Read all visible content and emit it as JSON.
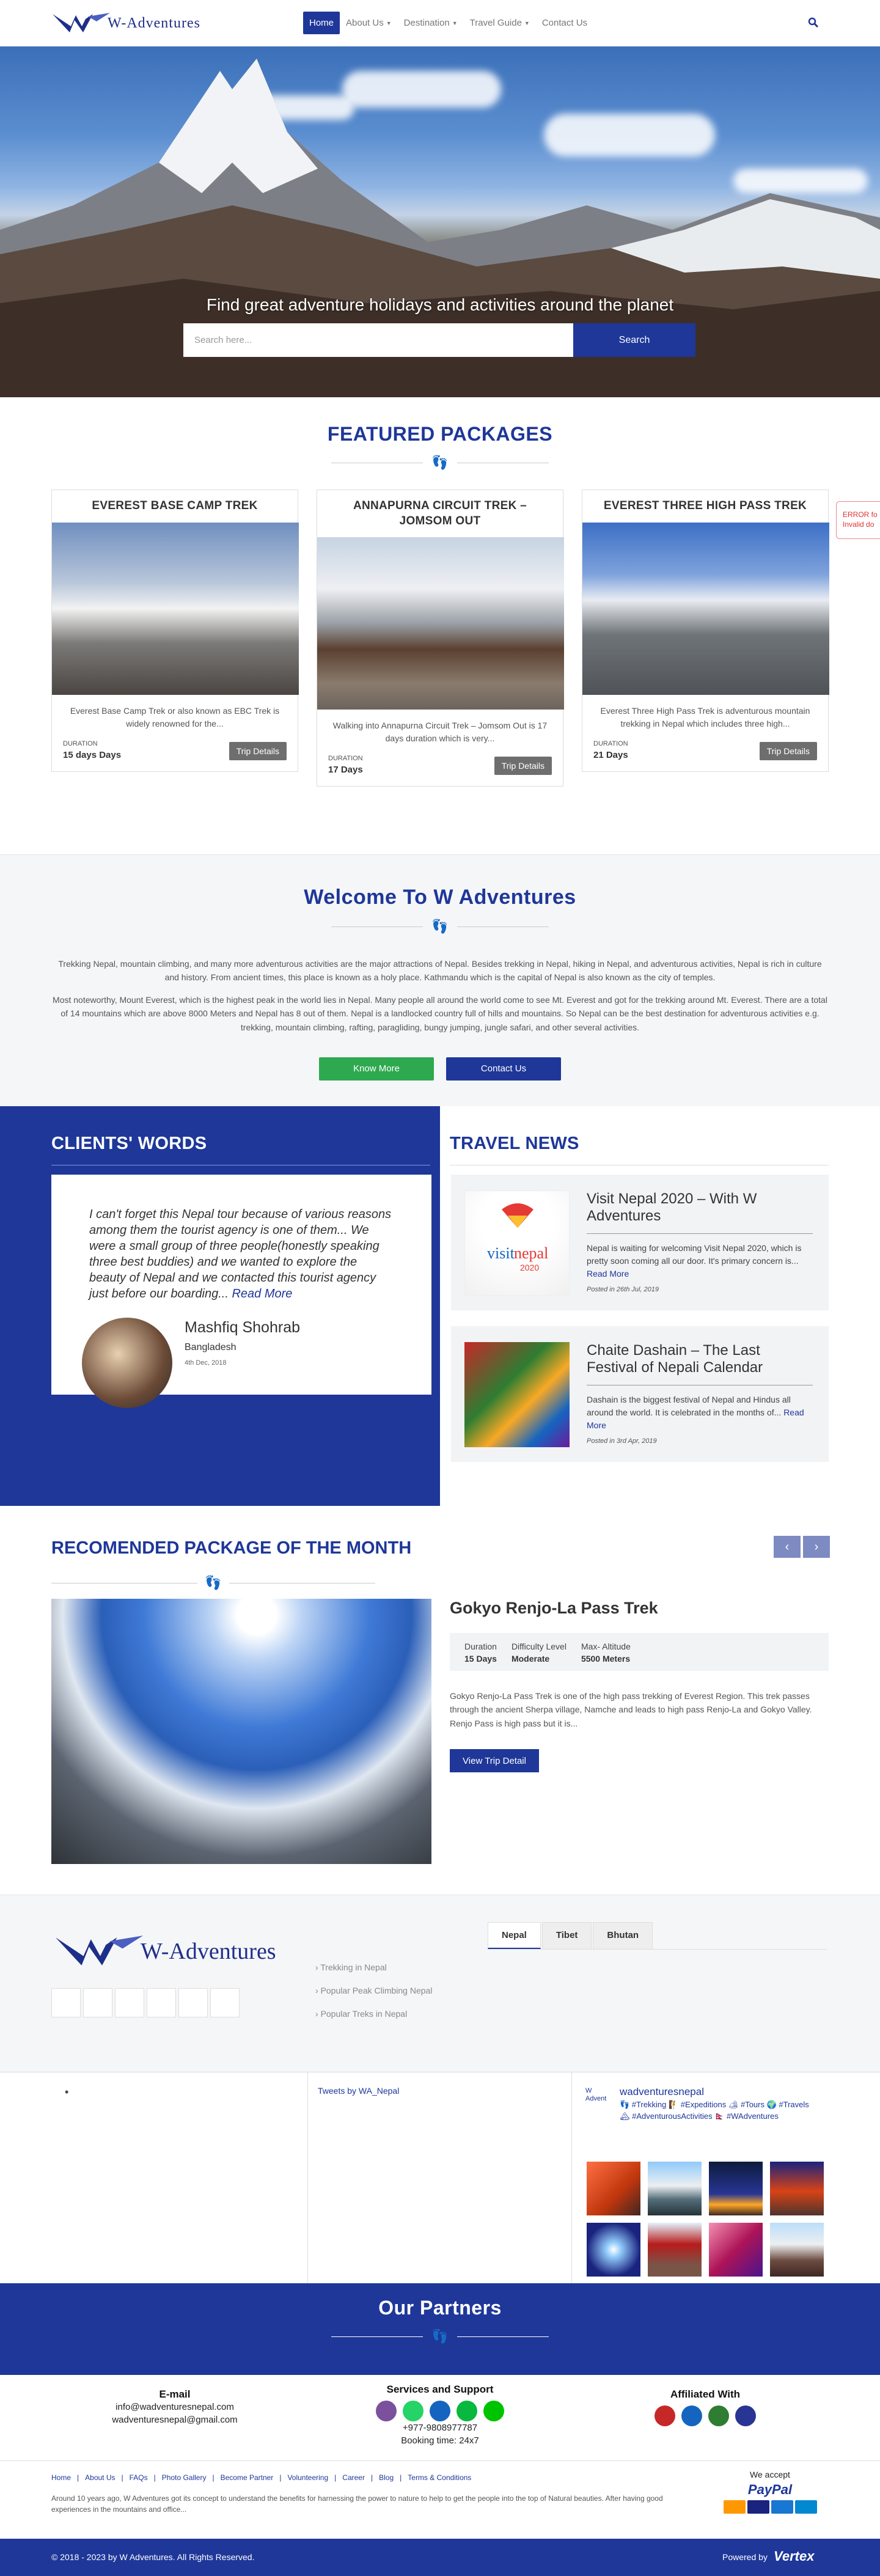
{
  "header": {
    "logo_text": "W-Adventures",
    "nav": [
      {
        "label": "Home",
        "active": true,
        "dropdown": false
      },
      {
        "label": "About Us",
        "active": false,
        "dropdown": true
      },
      {
        "label": "Destination",
        "active": false,
        "dropdown": true
      },
      {
        "label": "Travel Guide",
        "active": false,
        "dropdown": true
      },
      {
        "label": "Contact Us",
        "active": false,
        "dropdown": false
      }
    ],
    "search_icon": "search-icon"
  },
  "hero": {
    "title": "Find great adventure holidays and activities around the planet",
    "search_placeholder": "Search here...",
    "search_button": "Search"
  },
  "featured": {
    "title": "FEATURED PACKAGES",
    "packages": [
      {
        "title": "EVEREST BASE CAMP TREK",
        "desc": "Everest Base Camp Trek or also known as EBC Trek is widely renowned for the...",
        "duration_label": "DURATION",
        "duration": "15 days Days",
        "button": "Trip Details"
      },
      {
        "title": "ANNAPURNA CIRCUIT TREK – JOMSOM OUT",
        "desc": "Walking into Annapurna Circuit Trek – Jomsom Out is 17 days duration which is very...",
        "duration_label": "DURATION",
        "duration": "17 Days",
        "button": "Trip Details"
      },
      {
        "title": "EVEREST THREE HIGH PASS TREK",
        "desc": "Everest Three High Pass Trek is adventurous mountain trekking in Nepal which includes three high...",
        "duration_label": "DURATION",
        "duration": "21 Days",
        "button": "Trip Details"
      }
    ],
    "error_text": "ERROR fo Invalid do"
  },
  "welcome": {
    "title": "Welcome To W Adventures",
    "p1": "Trekking Nepal, mountain climbing, and many more adventurous activities are the major attractions of Nepal. Besides trekking in Nepal, hiking in Nepal, and adventurous activities, Nepal is rich in culture and history. From ancient times, this place is known as a holy place. Kathmandu which is the capital of Nepal is also known as the city of temples.",
    "p2": "Most noteworthy, Mount Everest, which is the highest peak in the world lies in Nepal. Many people all around the world come to see Mt. Everest and got for the trekking around Mt. Everest. There are a total of 14 mountains which are above 8000 Meters and Nepal has 8 out of them. Nepal is a landlocked country full of hills and mountains. So Nepal can be the best destination for adventurous activities e.g. trekking, mountain climbing, rafting, paragliding, bungy jumping, jungle safari, and other several activities.",
    "know_more": "Know More",
    "contact_us": "Contact Us"
  },
  "clients": {
    "title": "CLIENTS' WORDS",
    "quote": "I can't forget this Nepal tour because of various reasons among them the tourist agency is one of them... We were a small group of three people(honestly speaking three best buddies) and we wanted to explore the beauty of Nepal and we contacted this tourist agency just before our boarding...",
    "read_more": "Read More",
    "name": "Mashfiq Shohrab",
    "country": "Bangladesh",
    "date": "4th Dec, 2018"
  },
  "news": {
    "title": "TRAVEL NEWS",
    "items": [
      {
        "title": "Visit Nepal 2020 – With W Adventures",
        "desc": "Nepal is waiting for welcoming Visit Nepal 2020, which is pretty soon coming all our door. It's primary concern is...",
        "read_more": "Read More",
        "posted": "Posted in 26th Jul, 2019"
      },
      {
        "title": "Chaite Dashain – The Last Festival of Nepali Calendar",
        "desc": "Dashain is the biggest festival of Nepal and Hindus all around the world. It is celebrated in the months of...",
        "read_more": "Read More",
        "posted": "Posted in 3rd Apr, 2019"
      }
    ]
  },
  "recommended": {
    "title": "RECOMENDED PACKAGE OF THE MONTH",
    "name": "Gokyo Renjo-La Pass Trek",
    "specs": [
      {
        "label": "Duration",
        "value": "15 Days"
      },
      {
        "label": "Difficulty Level",
        "value": "Moderate"
      },
      {
        "label": "Max- Altitude",
        "value": "5500 Meters"
      }
    ],
    "desc": "Gokyo Renjo-La Pass Trek is one of the high pass trekking of Everest Region. This trek passes through the ancient Sherpa village, Namche and leads to high pass Renjo-La and Gokyo Valley. Renjo Pass is high pass but it is...",
    "button": "View Trip Detail"
  },
  "lower": {
    "logo_text": "W-Adventures",
    "tabs": [
      "Nepal",
      "Tibet",
      "Bhutan"
    ],
    "links": [
      "Trekking in Nepal",
      "Popular Peak Climbing Nepal",
      "Popular Treks in Nepal"
    ]
  },
  "widgets": {
    "tweets": "Tweets by WA_Nepal",
    "ig_profile_alt": "W Advent",
    "ig_name": "wadventuresnepal",
    "ig_bio": "👣 #Trekking 🧗 #Expeditions 🏕 #Tours 🌍 #Travels 🏔 #AdventurousActivities 🇳🇵 #WAdventures"
  },
  "partners": {
    "title": "Our Partners"
  },
  "contact": {
    "email_title": "E-mail",
    "emails": [
      "info@wadventuresnepal.com",
      "wadventuresnepal@gmail.com"
    ],
    "services_title": "Services and Support",
    "phone": "+977-9808977787",
    "booking": "Booking time: 24x7",
    "affiliated_title": "Affiliated With"
  },
  "footer": {
    "links": [
      "Home",
      "About Us",
      "FAQs",
      "Photo Gallery",
      "Become Partner",
      "Volunteering",
      "Career",
      "Blog",
      "Terms & Conditions"
    ],
    "note": "Around 10 years ago, W Adventures got its concept to understand the benefits for harnessing the power to nature to help to get the people into the top of Natural beauties. After having good experiences in the mountains and office...",
    "accept": "We accept",
    "paypal": "PayPal",
    "copyright": "© 2018 - 2023 by W Adventures. All Rights Reserved.",
    "powered": "Powered by",
    "vertex": "Vertex"
  },
  "colors": {
    "brand": "#1e3799",
    "green": "#2ea94f",
    "grey_button": "#6e6e6e"
  }
}
